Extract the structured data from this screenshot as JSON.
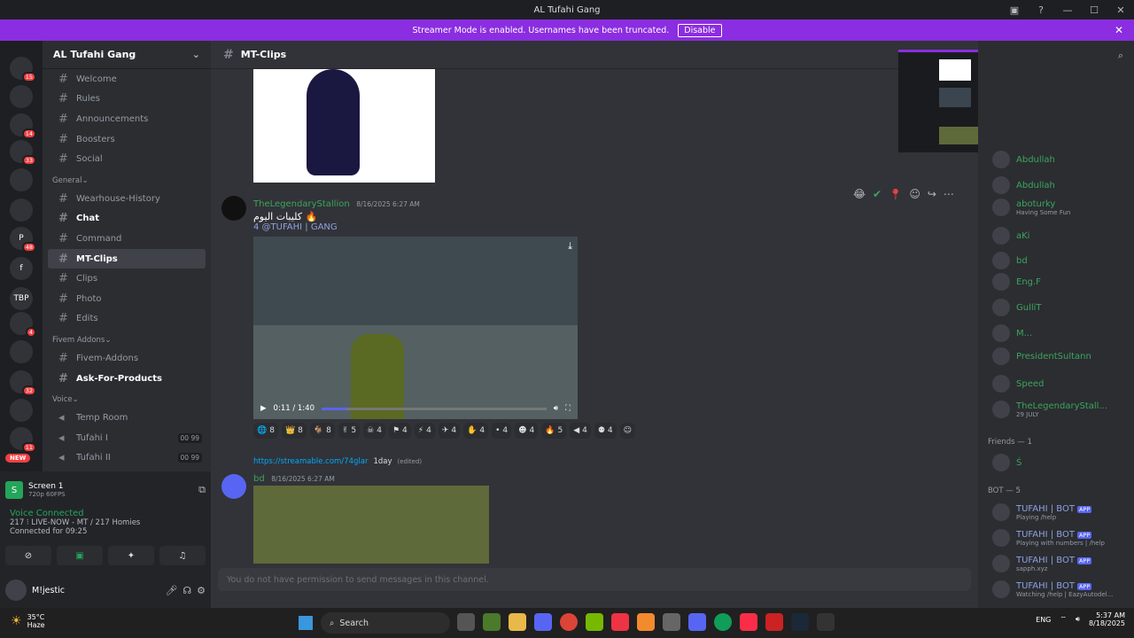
{
  "window": {
    "title": "AL Tufahi Gang"
  },
  "banner": {
    "text": "Streamer Mode is enabled. Usernames have been truncated.",
    "button": "Disable"
  },
  "servers": [
    {
      "label": "",
      "badge": "15"
    },
    {
      "label": "",
      "badge": ""
    },
    {
      "label": "",
      "badge": "14"
    },
    {
      "label": "",
      "badge": "33"
    },
    {
      "label": "",
      "badge": ""
    },
    {
      "label": "",
      "badge": ""
    },
    {
      "label": "P",
      "badge": "48"
    },
    {
      "label": "f",
      "badge": ""
    },
    {
      "label": "TBP",
      "badge": ""
    },
    {
      "label": "",
      "badge": "4"
    },
    {
      "label": "",
      "badge": ""
    },
    {
      "label": "",
      "badge": "32"
    },
    {
      "label": "",
      "badge": ""
    },
    {
      "label": "",
      "badge": "11"
    }
  ],
  "new_badge": "NEW",
  "server": {
    "name": "AL Tufahi Gang"
  },
  "channels_top": [
    {
      "name": "Welcome"
    },
    {
      "name": "Rules"
    },
    {
      "name": "Announcements"
    },
    {
      "name": "Boosters"
    },
    {
      "name": "Social"
    }
  ],
  "cat_general": "General",
  "channels_general": [
    {
      "name": "Wearhouse-History",
      "unread": false,
      "active": false
    },
    {
      "name": "Chat",
      "unread": true,
      "active": false
    },
    {
      "name": "Command",
      "unread": false,
      "active": false
    },
    {
      "name": "MT-Clips",
      "unread": false,
      "active": true
    },
    {
      "name": "Clips",
      "unread": false,
      "active": false
    },
    {
      "name": "Photo",
      "unread": false,
      "active": false
    },
    {
      "name": "Edits",
      "unread": false,
      "active": false
    }
  ],
  "cat_fivem": "Fivem Addons",
  "channels_fivem": [
    {
      "name": "Fivem-Addons",
      "unread": false
    },
    {
      "name": "Ask-For-Products",
      "unread": true
    }
  ],
  "cat_voice": "Voice",
  "voice_channels": [
    {
      "name": "Temp Room",
      "count": ""
    },
    {
      "name": "Tufahi I",
      "count": "00 99"
    },
    {
      "name": "Tufahi II",
      "count": "00 99"
    }
  ],
  "stream": {
    "title": "Screen 1",
    "quality": "720p 60FPS"
  },
  "voice": {
    "status": "Voice Connected",
    "channel": "217 ⁝ LIVE-NOW - MT / 217 Homies",
    "time": "Connected for 09:25"
  },
  "user": {
    "name": "M!jestic"
  },
  "chat": {
    "channel": "MT-Clips",
    "placeholder": "You do not have permission to send messages in this channel."
  },
  "msg1": {
    "author": "TheLegendaryStallion",
    "time": "8/16/2025 6:27 AM",
    "line1": "كليبات اليوم 🔥",
    "line2": "4 @TUFAHI | GANG"
  },
  "video": {
    "time": "0:11 / 1:40",
    "progress": 0.11
  },
  "reactions": [
    "8",
    "8",
    "8",
    "5",
    "4",
    "4",
    "4",
    "4",
    "4",
    "4",
    "4",
    "5",
    "4",
    "4"
  ],
  "msg2": {
    "reply_link": "https://streamable.com/74glar",
    "reply_extra": "1day",
    "reply_edited": "(edited)",
    "author": "bd",
    "time": "8/16/2025 6:27 AM"
  },
  "members": [
    {
      "name": "Abdullah",
      "status": "",
      "color": "#3ba55c"
    },
    {
      "name": "Abdullah",
      "status": "",
      "color": "#3ba55c"
    },
    {
      "name": "aboturky",
      "status": "Having Some Fun",
      "color": "#3ba55c"
    },
    {
      "name": "aKi",
      "status": "",
      "color": "#3ba55c"
    },
    {
      "name": "bd",
      "status": "",
      "color": "#3ba55c"
    },
    {
      "name": "Eng.F",
      "status": "",
      "color": "#3ba55c"
    },
    {
      "name": "GulliT",
      "status": "",
      "color": "#3ba55c"
    },
    {
      "name": "M...",
      "status": "",
      "color": "#3ba55c"
    },
    {
      "name": "PresidentSultann",
      "status": "",
      "color": "#3ba55c"
    },
    {
      "name": "Speed",
      "status": "",
      "color": "#3ba55c"
    },
    {
      "name": "TheLegendaryStall...",
      "status": "29 JULY",
      "color": "#3ba55c"
    }
  ],
  "friends_header": "Friends — 1",
  "friend": "Ś",
  "bot_header": "BOT — 5",
  "bots": [
    {
      "name": "TUFAHI | BOT",
      "tag": "APP",
      "status": "Playing /help"
    },
    {
      "name": "TUFAHI | BOT",
      "tag": "APP",
      "status": "Playing with numbers | /help"
    },
    {
      "name": "TUFAHI | BOT",
      "tag": "APP",
      "status": "sapph.xyz"
    },
    {
      "name": "TUFAHI | BOT",
      "tag": "APP",
      "status": "Watching /help | EazyAutodel..."
    }
  ],
  "taskbar": {
    "weather_temp": "35°C",
    "weather_desc": "Haze",
    "search": "Search",
    "lang": "ENG",
    "time": "5:37 AM",
    "date": "8/18/2025"
  }
}
